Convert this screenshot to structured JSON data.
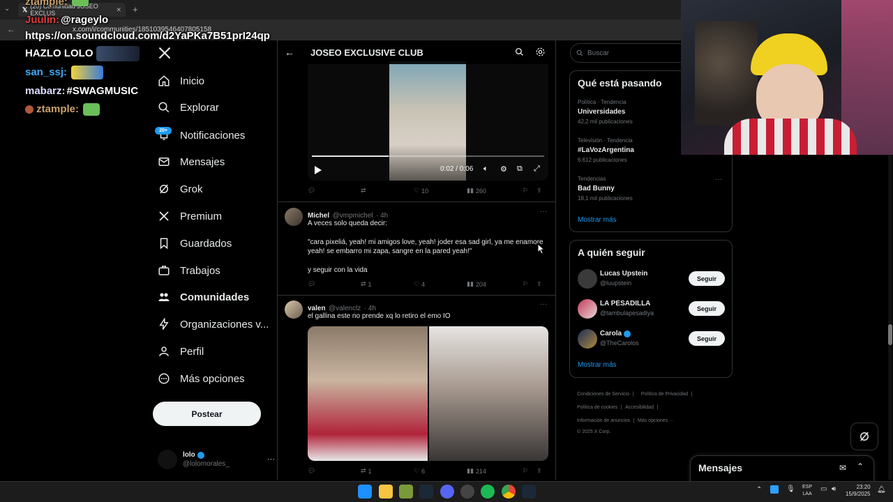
{
  "browser": {
    "tab_title": "(20) Comunidad JOSEO EXCLUS",
    "url": "x.com/i/communities/1851039546407805158"
  },
  "stream_chat": {
    "lines": [
      {
        "user": "ztample:",
        "text": ""
      },
      {
        "user": "Juulin:",
        "text": "@rageylo"
      },
      {
        "user": "",
        "text": "https://on.soundcloud.com/d2YaPKa7B51prI24qp"
      },
      {
        "user": "",
        "text": "HAZLO LOLO"
      },
      {
        "user": "san_ssj:",
        "text": ""
      },
      {
        "user": "mabarz:",
        "text": "#SWAGMUSIC"
      },
      {
        "user": "ztample:",
        "text": ""
      }
    ]
  },
  "nav": {
    "items": [
      {
        "label": "Inicio",
        "icon": "home-icon"
      },
      {
        "label": "Explorar",
        "icon": "search-icon"
      },
      {
        "label": "Notificaciones",
        "icon": "bell-icon"
      },
      {
        "label": "Mensajes",
        "icon": "mail-icon"
      },
      {
        "label": "Grok",
        "icon": "grok-icon"
      },
      {
        "label": "Premium",
        "icon": "x-logo-icon"
      },
      {
        "label": "Guardados",
        "icon": "bookmark-icon"
      },
      {
        "label": "Trabajos",
        "icon": "briefcase-icon"
      },
      {
        "label": "Comunidades",
        "icon": "communities-icon"
      },
      {
        "label": "Organizaciones v...",
        "icon": "lightning-icon"
      },
      {
        "label": "Perfil",
        "icon": "person-icon"
      },
      {
        "label": "Más opciones",
        "icon": "more-circle-icon"
      }
    ],
    "notif_badge": "20+",
    "post_button": "Postear",
    "account": {
      "name": "lolo",
      "handle": "@lolomorales_"
    }
  },
  "timeline": {
    "title": "JOSEO EXCLUSIVE CLUB",
    "video": {
      "time": "0:02 / 0:06",
      "progress": 0.33
    },
    "tweets": [
      {
        "stats": {
          "replies": "",
          "retweets": "",
          "likes": "10",
          "views": "260"
        }
      },
      {
        "name": "Michel",
        "handle": "@vmpmichel",
        "time": "· 4h",
        "text1": "A veces solo queda decir:",
        "text2": "\"cara pixeliá, yeah! mi amigos love, yeah! joder esa sad girl, ya me enamore",
        "text3": "yeah! se embarro mi zapa, sangre en la pared yeah!\"",
        "text4": "y seguir con la vida",
        "stats": {
          "replies": "",
          "retweets": "1",
          "likes": "4",
          "views": "204"
        }
      },
      {
        "name": "valen",
        "handle": "@valenclz",
        "time": "· 4h",
        "text1": "el gallina este no prende xq lo retiro el emo IO",
        "stats": {
          "replies": "",
          "retweets": "1",
          "likes": "6",
          "views": "214"
        }
      }
    ]
  },
  "right": {
    "search_placeholder": "Buscar",
    "trends_title": "Qué está pasando",
    "trends": [
      {
        "category": "Política · Tendencia",
        "name": "Universidades",
        "count": "42,2 mil publicaciones"
      },
      {
        "category": "Televisión · Tendencia",
        "name": "#LaVozArgentina",
        "count": "6.612 publicaciones"
      },
      {
        "category": "Tendencias",
        "name": "Bad Bunny",
        "count": "18,1 mil publicaciones"
      }
    ],
    "show_more": "Mostrar más",
    "follow_title": "A quién seguir",
    "follow": [
      {
        "name": "Lucas Upstein",
        "handle": "@luupstein",
        "button": "Seguir"
      },
      {
        "name": "LA PESADILLA",
        "handle": "@tambulapesadlya",
        "button": "Seguir"
      },
      {
        "name": "Carola",
        "handle": "@TheCarolos",
        "button": "Seguir"
      }
    ],
    "footer": [
      "Condiciones de Servicio",
      "Política de Privacidad",
      "Política de cookies",
      "Accesibilidad",
      "Información de anuncios",
      "Más opciones ···",
      "© 2025 X Corp."
    ],
    "messages_drawer": "Mensajes"
  },
  "taskbar": {
    "lang1": "ESP",
    "lang2": "LAA",
    "time": "23:20",
    "date": "15/9/2025"
  },
  "colors": {
    "accent": "#1d9bf0",
    "border": "#2f3336",
    "muted": "#71767b"
  }
}
